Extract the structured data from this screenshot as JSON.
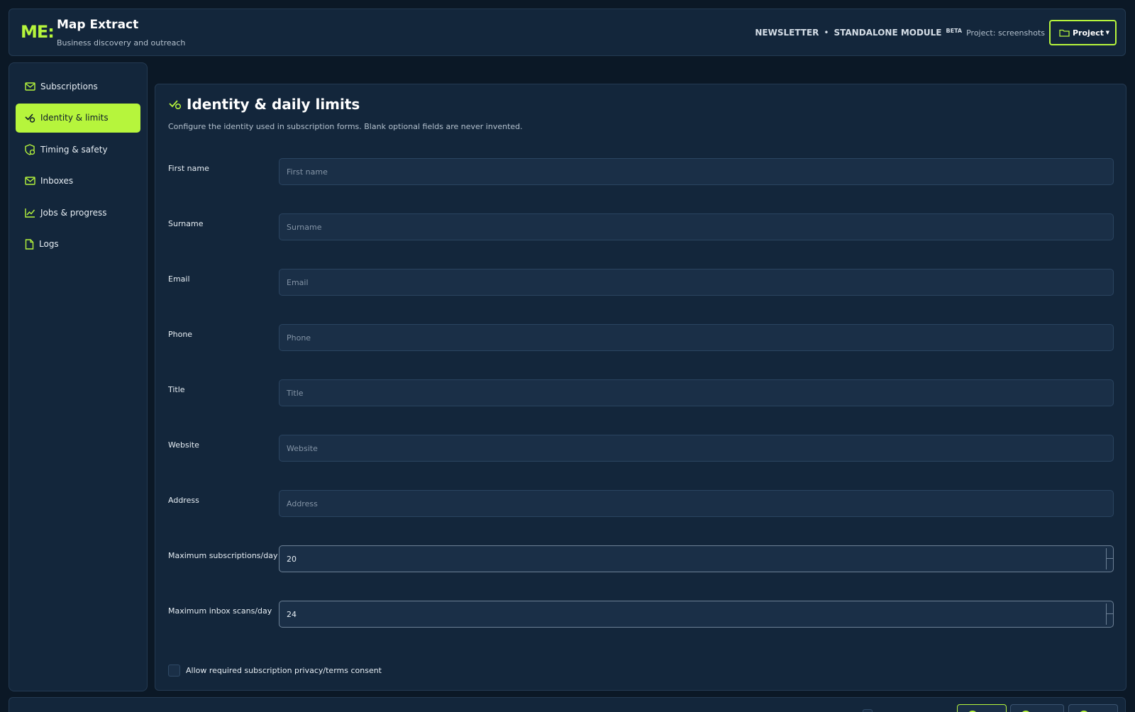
{
  "header": {
    "logo": "ME:",
    "title": "Map Extract",
    "subtitle": "Business discovery and outreach",
    "nav_newsletter": "NEWSLETTER",
    "separator": "•",
    "nav_module": "STANDALONE MODULE",
    "beta": "BETA",
    "project_info": "Project: screenshots",
    "project_button": "Project",
    "accent_color": "#b6f53c"
  },
  "sidebar": {
    "items": [
      {
        "label": "Subscriptions",
        "icon": "mail-icon"
      },
      {
        "label": "Identity & limits",
        "icon": "user-check-icon",
        "active": true
      },
      {
        "label": "Timing & safety",
        "icon": "shield-clock-icon"
      },
      {
        "label": "Inboxes",
        "icon": "mail-icon"
      },
      {
        "label": "Jobs & progress",
        "icon": "chart-line-icon"
      },
      {
        "label": "Logs",
        "icon": "file-icon"
      }
    ]
  },
  "main": {
    "title": "Identity & daily limits",
    "description": "Configure the identity used in subscription forms. Blank optional fields are never invented.",
    "fields": [
      {
        "label": "First name",
        "placeholder": "First name",
        "value": ""
      },
      {
        "label": "Surname",
        "placeholder": "Surname",
        "value": ""
      },
      {
        "label": "Email",
        "placeholder": "Email",
        "value": ""
      },
      {
        "label": "Phone",
        "placeholder": "Phone",
        "value": ""
      },
      {
        "label": "Title",
        "placeholder": "Title",
        "value": ""
      },
      {
        "label": "Website",
        "placeholder": "Website",
        "value": ""
      },
      {
        "label": "Address",
        "placeholder": "Address",
        "value": ""
      },
      {
        "label": "Maximum subscriptions/day",
        "placeholder": "",
        "value": "20"
      },
      {
        "label": "Maximum inbox scans/day",
        "placeholder": "",
        "value": "24"
      }
    ],
    "consent_label": "Allow required subscription privacy/terms consent",
    "consent_checked": false
  }
}
